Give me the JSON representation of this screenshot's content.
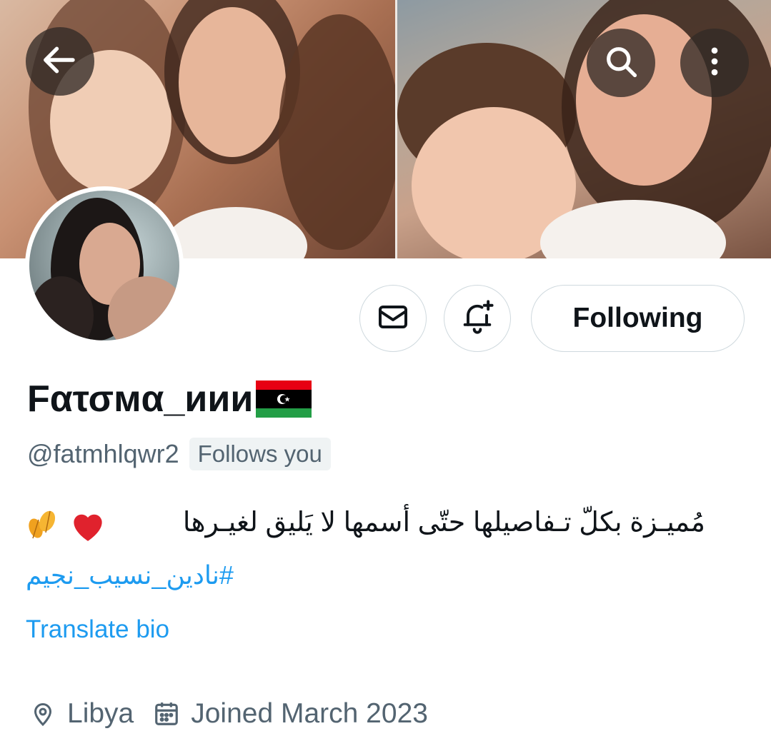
{
  "header": {
    "back_icon": "arrow-left-icon",
    "search_icon": "search-icon",
    "more_icon": "more-vertical-icon"
  },
  "profile": {
    "display_name": "Fατσмα_иии",
    "name_emoji": "libya-flag",
    "handle": "@fatmhlqwr2",
    "follows_you_badge": "Follows you",
    "bio": "مُميـزة بكلّ تـفاصيلها حتّى أسمها لا يَليق لغيـرها",
    "bio_emojis": [
      "red-heart",
      "autumn-leaves"
    ],
    "hashtag": "#نادين_نسيب_نجيم",
    "translate_label": "Translate bio",
    "location": "Libya",
    "joined": "Joined March 2023"
  },
  "actions": {
    "message_icon": "envelope-icon",
    "notify_icon": "bell-plus-icon",
    "following_label": "Following"
  },
  "colors": {
    "link": "#1d9bf0",
    "secondary_text": "#536471",
    "primary_text": "#0f1419",
    "border": "#cfd9de"
  }
}
